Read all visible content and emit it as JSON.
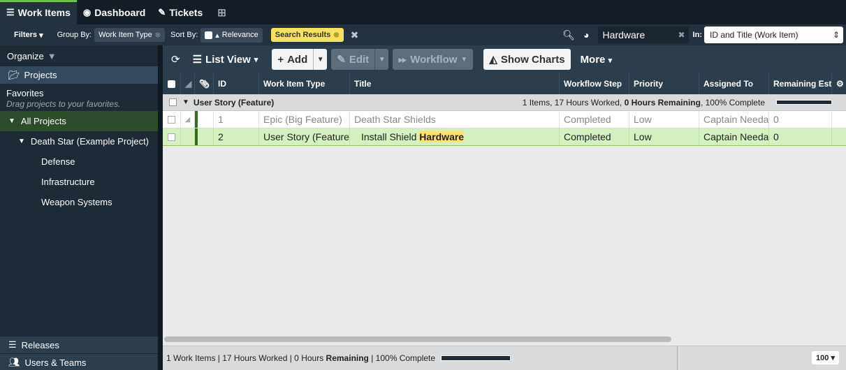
{
  "top_tabs": [
    {
      "label": "Work Items",
      "icon": "list-icon",
      "active": true
    },
    {
      "label": "Dashboard",
      "icon": "dashboard-icon",
      "active": false
    },
    {
      "label": "Tickets",
      "icon": "tag-icon",
      "active": false
    }
  ],
  "filterbar": {
    "filters_label": "Filters",
    "group_by_label": "Group By:",
    "group_by_value": "Work Item Type",
    "sort_by_label": "Sort By:",
    "sort_by_value": "Relevance",
    "search_results_label": "Search Results",
    "search_value": "Hardware",
    "in_label": "In:",
    "in_select_value": "ID and Title (Work Item)"
  },
  "sidebar": {
    "organize_label": "Organize",
    "projects_label": "Projects",
    "favorites_label": "Favorites",
    "favorites_hint": "Drag projects to your favorites.",
    "all_projects_label": "All Projects",
    "tree": [
      {
        "label": "Death Star (Example Project)",
        "level": 1
      },
      {
        "label": "Defense",
        "level": 2
      },
      {
        "label": "Infrastructure",
        "level": 2
      },
      {
        "label": "Weapon Systems",
        "level": 2
      }
    ],
    "releases_label": "Releases",
    "users_teams_label": "Users & Teams"
  },
  "toolbar": {
    "list_view_label": "List View",
    "add_label": "Add",
    "edit_label": "Edit",
    "workflow_label": "Workflow",
    "show_charts_label": "Show Charts",
    "more_label": "More"
  },
  "table": {
    "columns": [
      "ID",
      "Work Item Type",
      "Title",
      "Workflow Step",
      "Priority",
      "Assigned To",
      "Remaining Esti"
    ],
    "group": {
      "title": "User Story (Feature)",
      "summary_prefix": "1 Items, 17 Hours Worked, ",
      "summary_bold": "0 Hours Remaining",
      "summary_suffix": ", 100% Complete"
    },
    "rows": [
      {
        "id": "1",
        "type": "Epic (Big Feature)",
        "title": "Death Star Shields",
        "title_hl": "",
        "step": "Completed",
        "priority": "Low",
        "assigned": "Captain Needa",
        "remaining": "0"
      },
      {
        "id": "2",
        "type": "User Story (Feature)",
        "title": "Install Shield ",
        "title_hl": "Hardware",
        "step": "Completed",
        "priority": "Low",
        "assigned": "Captain Needa",
        "remaining": "0"
      }
    ]
  },
  "status": {
    "prefix": "1 Work Items | 17 Hours Worked | 0 Hours ",
    "bold": "Remaining",
    "suffix": " | 100% Complete",
    "page_size": "100"
  },
  "colors": {
    "accent_green": "#6cc24a",
    "search_highlight": "#f7e25c",
    "selected_row": "#d5f0c0"
  }
}
